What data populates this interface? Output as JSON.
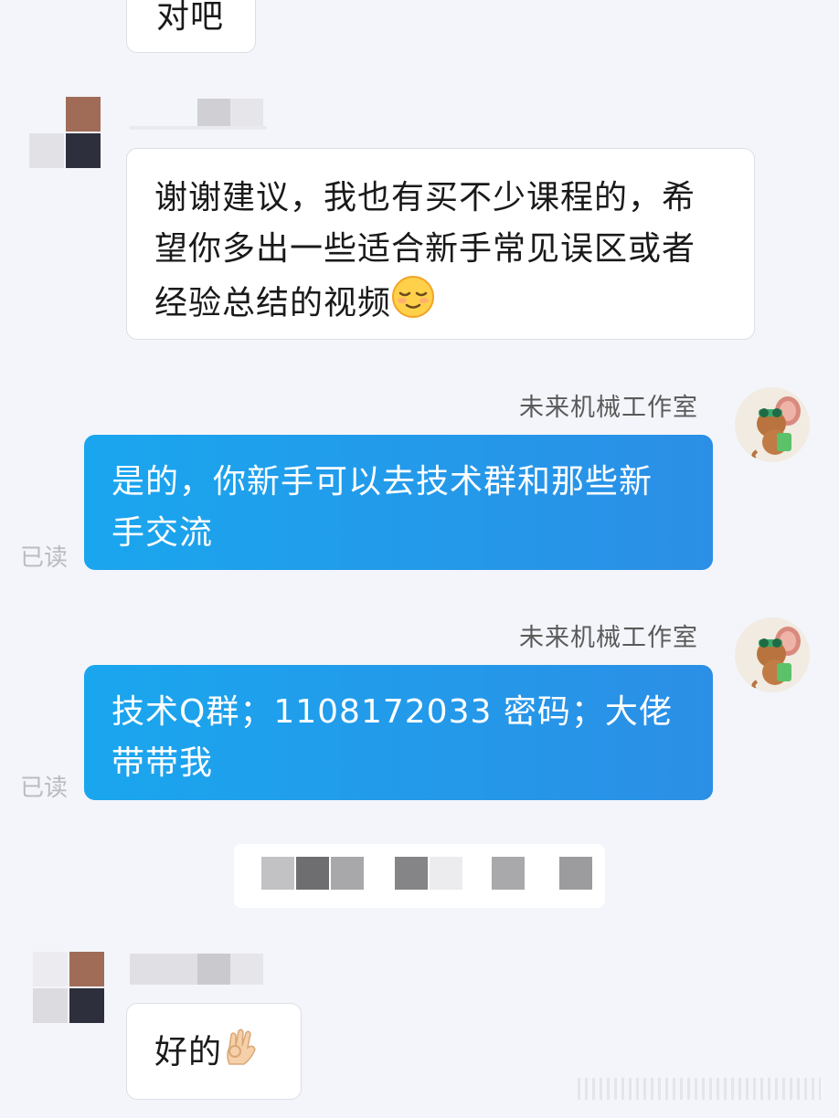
{
  "messages": {
    "m0_text": "对吧",
    "m1_text": "谢谢建议，我也有买不少课程的，希望你多出一些适合新手常见误区或者经验总结的视频",
    "m1_emoji": "relieved-face-emoji",
    "m2_sender": "未来机械工作室",
    "m2_text": "是的，你新手可以去技术群和那些新手交流",
    "m2_status": "已读",
    "m3_sender": "未来机械工作室",
    "m3_text": "技术Q群；1108172033  密码；大佬带带我",
    "m3_status": "已读",
    "m4_text": "好的",
    "m4_emoji": "ok-hand-emoji"
  },
  "colors": {
    "page_bg": "#f3f5fa",
    "incoming_bubble": "#ffffff",
    "outgoing_bubble_start": "#1aa6ee",
    "outgoing_bubble_end": "#2b8fe6",
    "read_status": "#b8bbc2"
  }
}
